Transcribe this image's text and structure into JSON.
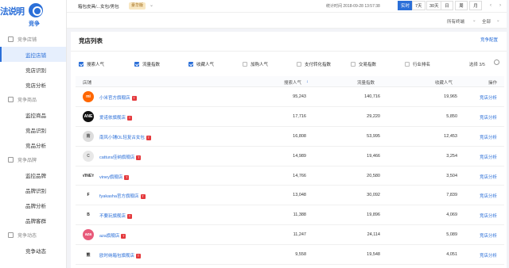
{
  "brand": {
    "watermark": "法说明",
    "name": "竞争"
  },
  "sidebar": {
    "sections": [
      {
        "label": "竞争店铺",
        "icon": "store-icon",
        "items": [
          {
            "label": "监控店铺",
            "active": true
          },
          {
            "label": "竞店识别",
            "active": false
          },
          {
            "label": "竞店分析",
            "active": false
          }
        ]
      },
      {
        "label": "竞争商品",
        "icon": "product-icon",
        "items": [
          {
            "label": "监控商品",
            "active": false
          },
          {
            "label": "竞品识别",
            "active": false
          },
          {
            "label": "竞品分析",
            "active": false
          }
        ]
      },
      {
        "label": "竞争品牌",
        "icon": "brand-icon",
        "items": [
          {
            "label": "监控品牌",
            "active": false
          },
          {
            "label": "品牌识别",
            "active": false
          },
          {
            "label": "品牌分析",
            "active": false
          },
          {
            "label": "品牌客群",
            "active": false
          }
        ]
      },
      {
        "label": "竞争动态",
        "icon": "dynamics-icon",
        "items": [
          {
            "label": "竞争动态",
            "active": false
          }
        ]
      }
    ]
  },
  "topbar": {
    "breadcrumb": "箱包皮具/...女包/男包",
    "vip_badge": "豪华版",
    "stat_time": "统计时间 2018-09-28 13:57:38",
    "periods": [
      "实时",
      "7天",
      "30天",
      "日",
      "周",
      "月"
    ],
    "active_period": "实时"
  },
  "filters": {
    "terminal": "所有终端",
    "scope": "全部"
  },
  "card": {
    "title": "竞店列表",
    "config_link": "竞争配置",
    "selected_count": "选择 3/5",
    "metrics": [
      {
        "label": "搜索人气",
        "checked": true
      },
      {
        "label": "流量指数",
        "checked": true
      },
      {
        "label": "收藏人气",
        "checked": true
      },
      {
        "label": "加购人气",
        "checked": false
      },
      {
        "label": "支付转化指数",
        "checked": false
      },
      {
        "label": "交易指数",
        "checked": false
      },
      {
        "label": "行业排名",
        "checked": false
      }
    ],
    "columns": {
      "shop": "店铺",
      "search": "搜索人气",
      "traffic": "流量指数",
      "fav": "收藏人气",
      "action": "操作"
    },
    "rows": [
      {
        "name": "小米官方旗舰店",
        "logo": "mi",
        "logo_bg": "#ff6700",
        "logo_fg": "#ffffff",
        "search": "95,243",
        "traffic": "140,716",
        "fav": "19,965",
        "action": "竞店分析"
      },
      {
        "name": "爱诺依旗舰店",
        "logo": "ANE",
        "logo_bg": "#111111",
        "logo_fg": "#ffffff",
        "search": "17,716",
        "traffic": "29,220",
        "fav": "5,850",
        "action": "竞店分析"
      },
      {
        "name": "南风小铺OL轻复古女包",
        "logo": "南",
        "logo_bg": "#dddddd",
        "logo_fg": "#555555",
        "search": "16,808",
        "traffic": "53,995",
        "fav": "12,453",
        "action": "竞店分析"
      },
      {
        "name": "cattura佳纳旗舰店",
        "logo": "C",
        "logo_bg": "#e8e8e8",
        "logo_fg": "#666666",
        "search": "14,989",
        "traffic": "19,466",
        "fav": "3,254",
        "action": "竞店分析"
      },
      {
        "name": "viney旗舰店",
        "logo": "VINEY",
        "logo_bg": "#ffffff",
        "logo_fg": "#333333",
        "search": "14,766",
        "traffic": "20,580",
        "fav": "3,504",
        "action": "竞店分析"
      },
      {
        "name": "fyakasha官方旗舰店",
        "logo": "F",
        "logo_bg": "#ffffff",
        "logo_fg": "#111111",
        "search": "13,048",
        "traffic": "30,092",
        "fav": "7,839",
        "action": "竞店分析"
      },
      {
        "name": "不要玩旗舰店",
        "logo": "B",
        "logo_bg": "#ffffff",
        "logo_fg": "#333333",
        "search": "11,388",
        "traffic": "19,896",
        "fav": "4,069",
        "action": "竞店分析"
      },
      {
        "name": "aza旗舰店",
        "logo": "aza",
        "logo_bg": "#e85a7a",
        "logo_fg": "#ffffff",
        "search": "11,247",
        "traffic": "24,114",
        "fav": "5,089",
        "action": "竞店分析"
      },
      {
        "name": "欧时纳箱包旗舰店",
        "logo": "熊",
        "logo_bg": "#ffffff",
        "logo_fg": "#222222",
        "search": "9,558",
        "traffic": "19,548",
        "fav": "4,051",
        "action": "竞店分析"
      }
    ]
  }
}
